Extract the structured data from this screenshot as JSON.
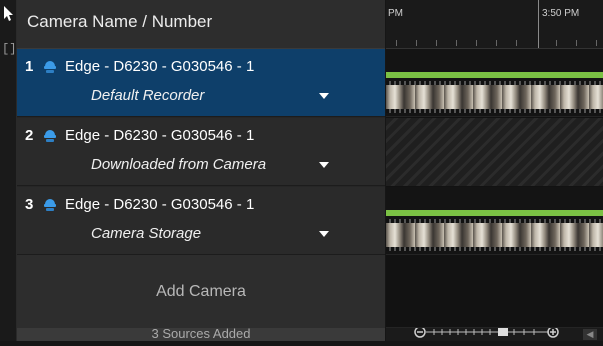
{
  "header": {
    "title": "Camera Name / Number"
  },
  "cameras": [
    {
      "number": "1",
      "name": "Edge - D6230 - G030546 - 1",
      "source": "Default Recorder",
      "selected": true,
      "recording": "footage"
    },
    {
      "number": "2",
      "name": "Edge - D6230 - G030546 - 1",
      "source": "Downloaded from Camera",
      "selected": false,
      "recording": "none"
    },
    {
      "number": "3",
      "name": "Edge - D6230 - G030546 - 1",
      "source": "Camera Storage",
      "selected": false,
      "recording": "footage"
    }
  ],
  "add_camera_label": "Add Camera",
  "sources_added": "3 Sources Added",
  "timeline": {
    "time_labels": [
      "PM",
      "3:50 PM"
    ]
  },
  "colors": {
    "selected_row": "#0e3f6a",
    "recording_bar": "#7bc144",
    "camera_icon": "#3b9be8"
  },
  "icons": [
    "pointer-icon",
    "selection-bracket-icon",
    "camera-dome-icon",
    "chevron-down-icon",
    "zoom-out-icon",
    "zoom-in-icon",
    "scroll-left-icon"
  ]
}
